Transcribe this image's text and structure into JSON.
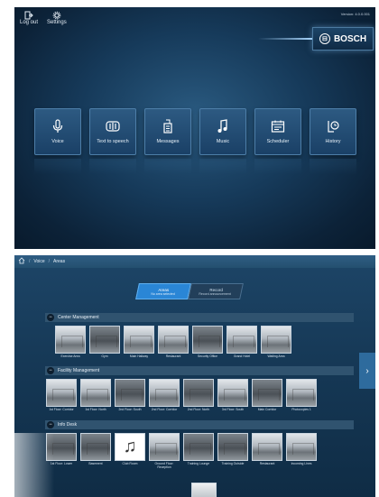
{
  "home": {
    "logout_label": "Log out",
    "settings_label": "Settings",
    "version": "Version: 4.0.0.001",
    "brand": "BOSCH",
    "tiles": [
      {
        "label": "Voice",
        "icon": "microphone-icon"
      },
      {
        "label": "Text to speech",
        "icon": "text-to-speech-icon"
      },
      {
        "label": "Messages",
        "icon": "messages-icon"
      },
      {
        "label": "Music",
        "icon": "music-note-icon"
      },
      {
        "label": "Scheduler",
        "icon": "calendar-icon"
      },
      {
        "label": "History",
        "icon": "history-icon"
      }
    ]
  },
  "areas": {
    "breadcrumb": [
      "Voice",
      "Areas"
    ],
    "segment": [
      {
        "label": "Areas",
        "sub": "No area selected"
      },
      {
        "label": "Record",
        "sub": "Record announcement"
      }
    ],
    "groups": [
      {
        "title": "Center Management",
        "items": [
          "Exercise Area",
          "Gym",
          "Main Hallway",
          "Restaurant",
          "Security Office",
          "Grand Hotel",
          "Waiting Area"
        ]
      },
      {
        "title": "Facility Management",
        "items": [
          "1st Floor: Corridor",
          "1st Floor: North",
          "2nd Floor: South",
          "2nd Floor: Corridor",
          "2nd Floor: North",
          "3rd Floor: South",
          "Main Corridor",
          "Photocopies 1"
        ]
      },
      {
        "title": "Info Desk",
        "items": [
          "1st Floor: Lower",
          "Basement",
          "Club Room",
          "Ground Floor: Reception",
          "Training Lounge",
          "Training Outside",
          "Restaurant",
          "Incoming Lines"
        ]
      }
    ]
  }
}
